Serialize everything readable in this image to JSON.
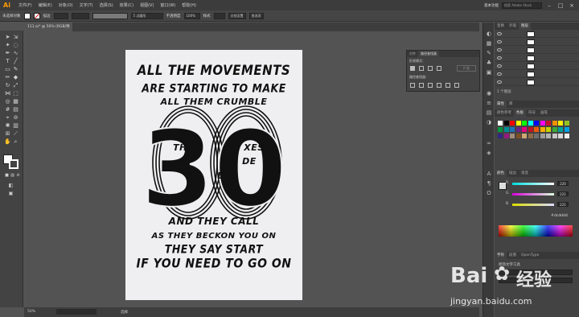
{
  "menubar": {
    "logo": "Ai",
    "items": [
      "文件(F)",
      "编辑(E)",
      "对象(O)",
      "文字(T)",
      "选择(S)",
      "效果(C)",
      "视图(V)",
      "窗口(W)",
      "帮助(H)"
    ],
    "workspace": "基本功能",
    "search_placeholder": "搜索 Adobe Stock",
    "window_buttons": [
      "–",
      "□",
      "×"
    ]
  },
  "ctrlbar": {
    "selection": "未选择对象",
    "stroke_label": "描边",
    "stroke_value": "",
    "brush": "5 点圆形",
    "opacity_label": "不透明度",
    "opacity_value": "100%",
    "style_label": "样式",
    "doc_setup": "文档设置",
    "preferences": "首选项"
  },
  "document": {
    "tab_title": "111.ai* @ 50% (RGB/预览)",
    "zoom": "50%",
    "status_tool": "选择"
  },
  "poster": {
    "lines": [
      "ALL THE MOVEMENTS",
      "ARE STARTING TO MAKE",
      "ALL THEM CRUMBLE",
      "AS THEY BECKON YOU ON",
      "THEY SAY START",
      "IF YOU NEED TO GO ON"
    ],
    "middle_fragments": [
      "TH",
      "XES",
      "T",
      "DE",
      "S",
      "L",
      "AND THEY CALL"
    ],
    "big_number": "30"
  },
  "float_panel": {
    "tabs": [
      "对齐",
      "路径查找器"
    ],
    "row1_label": "形状模式：",
    "row2_label": "路径查找器：",
    "expand_button": "扩展"
  },
  "layers_panel": {
    "tabs": [
      "变换",
      "外观",
      "图层"
    ],
    "footer": "1 个图层"
  },
  "properties_panel": {
    "tabs": [
      "属性",
      "库"
    ]
  },
  "swatches_panel": {
    "tabs": [
      "颜色参考",
      "色板",
      "符号",
      "画笔"
    ],
    "colors": [
      "#ffffff",
      "#000000",
      "#ff0000",
      "#ffff00",
      "#00ff00",
      "#00ffff",
      "#0000ff",
      "#ff00ff",
      "#c8102e",
      "#f39200",
      "#ffed00",
      "#95c11f",
      "#009640",
      "#008d95",
      "#1d71b8",
      "#662483",
      "#e5007e",
      "#be1622",
      "#ea5b0c",
      "#f8ad00",
      "#c5d300",
      "#3aaa35",
      "#00a19a",
      "#009fe3",
      "#312783",
      "#951b81",
      "#a48a7b",
      "#7d4e24",
      "#cfa774",
      "#8f6b4a",
      "#706f6f",
      "#9d9d9c",
      "#b2b2b2",
      "#c6c6c6",
      "#dadada",
      "#ededed"
    ]
  },
  "color_panel": {
    "tabs": [
      "颜色",
      "描边",
      "渐变"
    ],
    "channels": [
      {
        "label": "R",
        "value": "220"
      },
      {
        "label": "G",
        "value": "221"
      },
      {
        "label": "B",
        "value": "221"
      }
    ],
    "hex": "dcdddd"
  },
  "char_panel": {
    "tabs": [
      "字符",
      "段落",
      "OpenType"
    ],
    "font": "修饰文字工具"
  },
  "watermark": {
    "brand": "Bai",
    "brand2": "经验",
    "url": "jingyan.baidu.com"
  }
}
